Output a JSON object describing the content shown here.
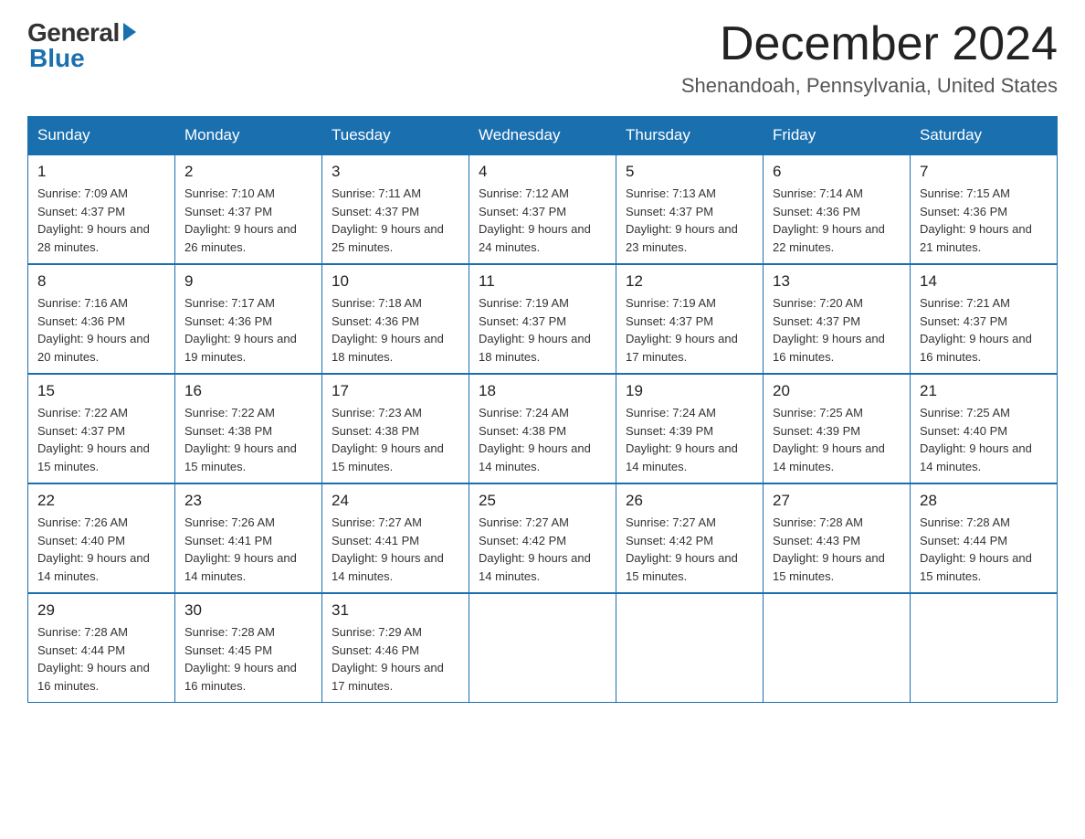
{
  "header": {
    "logo_general": "General",
    "logo_blue": "Blue",
    "month_title": "December 2024",
    "location": "Shenandoah, Pennsylvania, United States"
  },
  "weekdays": [
    "Sunday",
    "Monday",
    "Tuesday",
    "Wednesday",
    "Thursday",
    "Friday",
    "Saturday"
  ],
  "weeks": [
    [
      {
        "day": "1",
        "sunrise": "7:09 AM",
        "sunset": "4:37 PM",
        "daylight": "9 hours and 28 minutes."
      },
      {
        "day": "2",
        "sunrise": "7:10 AM",
        "sunset": "4:37 PM",
        "daylight": "9 hours and 26 minutes."
      },
      {
        "day": "3",
        "sunrise": "7:11 AM",
        "sunset": "4:37 PM",
        "daylight": "9 hours and 25 minutes."
      },
      {
        "day": "4",
        "sunrise": "7:12 AM",
        "sunset": "4:37 PM",
        "daylight": "9 hours and 24 minutes."
      },
      {
        "day": "5",
        "sunrise": "7:13 AM",
        "sunset": "4:37 PM",
        "daylight": "9 hours and 23 minutes."
      },
      {
        "day": "6",
        "sunrise": "7:14 AM",
        "sunset": "4:36 PM",
        "daylight": "9 hours and 22 minutes."
      },
      {
        "day": "7",
        "sunrise": "7:15 AM",
        "sunset": "4:36 PM",
        "daylight": "9 hours and 21 minutes."
      }
    ],
    [
      {
        "day": "8",
        "sunrise": "7:16 AM",
        "sunset": "4:36 PM",
        "daylight": "9 hours and 20 minutes."
      },
      {
        "day": "9",
        "sunrise": "7:17 AM",
        "sunset": "4:36 PM",
        "daylight": "9 hours and 19 minutes."
      },
      {
        "day": "10",
        "sunrise": "7:18 AM",
        "sunset": "4:36 PM",
        "daylight": "9 hours and 18 minutes."
      },
      {
        "day": "11",
        "sunrise": "7:19 AM",
        "sunset": "4:37 PM",
        "daylight": "9 hours and 18 minutes."
      },
      {
        "day": "12",
        "sunrise": "7:19 AM",
        "sunset": "4:37 PM",
        "daylight": "9 hours and 17 minutes."
      },
      {
        "day": "13",
        "sunrise": "7:20 AM",
        "sunset": "4:37 PM",
        "daylight": "9 hours and 16 minutes."
      },
      {
        "day": "14",
        "sunrise": "7:21 AM",
        "sunset": "4:37 PM",
        "daylight": "9 hours and 16 minutes."
      }
    ],
    [
      {
        "day": "15",
        "sunrise": "7:22 AM",
        "sunset": "4:37 PM",
        "daylight": "9 hours and 15 minutes."
      },
      {
        "day": "16",
        "sunrise": "7:22 AM",
        "sunset": "4:38 PM",
        "daylight": "9 hours and 15 minutes."
      },
      {
        "day": "17",
        "sunrise": "7:23 AM",
        "sunset": "4:38 PM",
        "daylight": "9 hours and 15 minutes."
      },
      {
        "day": "18",
        "sunrise": "7:24 AM",
        "sunset": "4:38 PM",
        "daylight": "9 hours and 14 minutes."
      },
      {
        "day": "19",
        "sunrise": "7:24 AM",
        "sunset": "4:39 PM",
        "daylight": "9 hours and 14 minutes."
      },
      {
        "day": "20",
        "sunrise": "7:25 AM",
        "sunset": "4:39 PM",
        "daylight": "9 hours and 14 minutes."
      },
      {
        "day": "21",
        "sunrise": "7:25 AM",
        "sunset": "4:40 PM",
        "daylight": "9 hours and 14 minutes."
      }
    ],
    [
      {
        "day": "22",
        "sunrise": "7:26 AM",
        "sunset": "4:40 PM",
        "daylight": "9 hours and 14 minutes."
      },
      {
        "day": "23",
        "sunrise": "7:26 AM",
        "sunset": "4:41 PM",
        "daylight": "9 hours and 14 minutes."
      },
      {
        "day": "24",
        "sunrise": "7:27 AM",
        "sunset": "4:41 PM",
        "daylight": "9 hours and 14 minutes."
      },
      {
        "day": "25",
        "sunrise": "7:27 AM",
        "sunset": "4:42 PM",
        "daylight": "9 hours and 14 minutes."
      },
      {
        "day": "26",
        "sunrise": "7:27 AM",
        "sunset": "4:42 PM",
        "daylight": "9 hours and 15 minutes."
      },
      {
        "day": "27",
        "sunrise": "7:28 AM",
        "sunset": "4:43 PM",
        "daylight": "9 hours and 15 minutes."
      },
      {
        "day": "28",
        "sunrise": "7:28 AM",
        "sunset": "4:44 PM",
        "daylight": "9 hours and 15 minutes."
      }
    ],
    [
      {
        "day": "29",
        "sunrise": "7:28 AM",
        "sunset": "4:44 PM",
        "daylight": "9 hours and 16 minutes."
      },
      {
        "day": "30",
        "sunrise": "7:28 AM",
        "sunset": "4:45 PM",
        "daylight": "9 hours and 16 minutes."
      },
      {
        "day": "31",
        "sunrise": "7:29 AM",
        "sunset": "4:46 PM",
        "daylight": "9 hours and 17 minutes."
      },
      null,
      null,
      null,
      null
    ]
  ]
}
